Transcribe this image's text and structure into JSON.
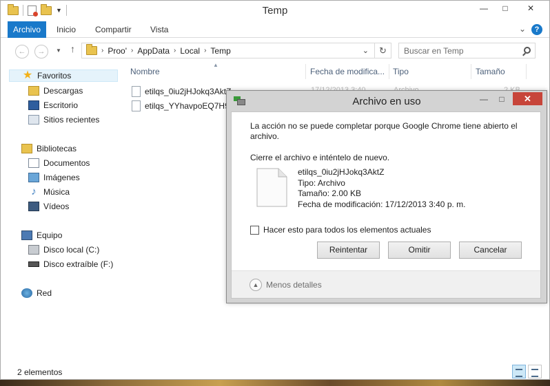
{
  "window": {
    "title": "Temp"
  },
  "ribbon": {
    "tabs": [
      "Archivo",
      "Inicio",
      "Compartir",
      "Vista"
    ]
  },
  "address": {
    "crumbs": [
      "Proo'",
      "AppData",
      "Local",
      "Temp"
    ]
  },
  "search": {
    "placeholder": "Buscar en Temp"
  },
  "nav": {
    "favorites": "Favoritos",
    "fav_items": [
      "Descargas",
      "Escritorio",
      "Sitios recientes"
    ],
    "libraries": "Bibliotecas",
    "lib_items": [
      "Documentos",
      "Imágenes",
      "Música",
      "Vídeos"
    ],
    "computer": "Equipo",
    "pc_items": [
      "Disco local (C:)",
      "Disco extraíble (F:)"
    ],
    "network": "Red"
  },
  "columns": [
    "Nombre",
    "Fecha de modifica...",
    "Tipo",
    "Tamaño"
  ],
  "files": [
    {
      "name": "etilqs_0iu2jHJokq3AktZ",
      "date": "17/12/2013 3:40",
      "type": "Archivo",
      "size": "2 KB"
    },
    {
      "name": "etilqs_YYhavpoEQ7H9J"
    }
  ],
  "status": {
    "count": "2 elementos"
  },
  "dialog": {
    "title": "Archivo en uso",
    "message": "La acción no se puede completar porque Google Chrome tiene abierto el archivo.",
    "instruction": "Cierre el archivo e inténtelo de nuevo.",
    "file_name": "etilqs_0iu2jHJokq3AktZ",
    "file_type": "Tipo: Archivo",
    "file_size": "Tamaño: 2.00 KB",
    "file_date": "Fecha de modificación: 17/12/2013 3:40 p. m.",
    "checkbox_label": "Hacer esto para todos los elementos actuales",
    "buttons": {
      "retry": "Reintentar",
      "skip": "Omitir",
      "cancel": "Cancelar"
    },
    "less_details": "Menos detalles"
  },
  "colors": {
    "accent": "#1979ca",
    "close": "#c7453a",
    "selection": "#e5f3fb"
  }
}
